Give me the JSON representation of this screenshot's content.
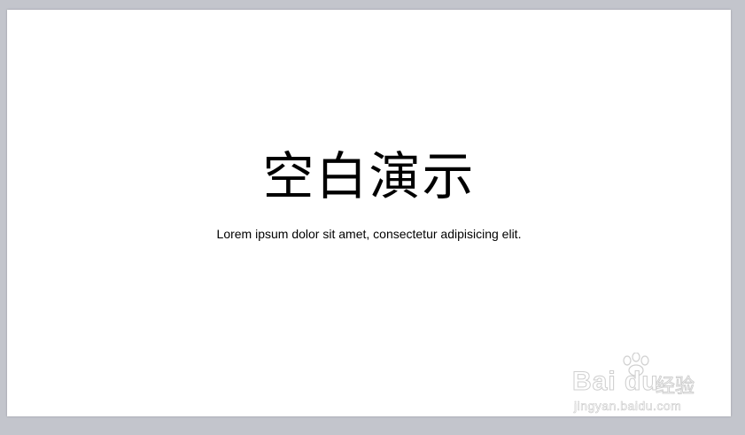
{
  "slide": {
    "title": "空白演示",
    "subtitle": "Lorem ipsum dolor sit amet, consectetur adipisicing elit."
  },
  "watermark": {
    "brand": "Bai du",
    "service": "经验",
    "url": "jingyan.baidu.com",
    "icon": "paw-icon"
  },
  "colors": {
    "workspace_background": "#c3c5cc",
    "slide_background": "#ffffff",
    "text": "#000000",
    "watermark": "#d4d4d4"
  }
}
